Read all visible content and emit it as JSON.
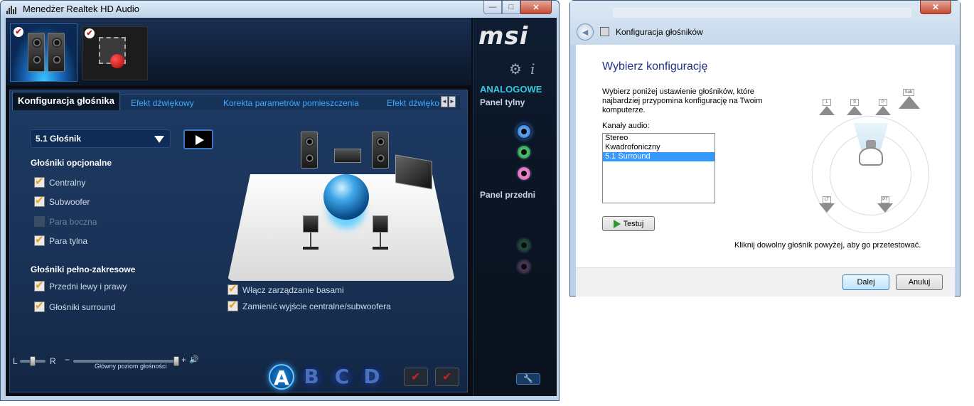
{
  "realtek": {
    "window_title": "Menedżer Realtek HD Audio",
    "title_buttons": {
      "minimize": "—",
      "maximize": "□",
      "close": "✕"
    },
    "brand": "msi",
    "devices": [
      {
        "name": "speakers",
        "checked": true,
        "active": true
      },
      {
        "name": "digital-output",
        "checked": true,
        "active": false
      }
    ],
    "side": {
      "gear_icon": "⚙",
      "info_icon": "i",
      "analog_title": "ANALOGOWE",
      "rear_panel": "Panel tylny",
      "front_panel": "Panel przedni",
      "rear_jacks": [
        "blue",
        "green",
        "pink"
      ],
      "front_jacks": [
        "green",
        "pink"
      ],
      "wrench_icon": "🔧"
    },
    "tabs": {
      "active": "Konfiguracja głośnika",
      "others": [
        "Efekt dźwiękowy",
        "Korekta parametrów pomieszczenia",
        "Efekt dźwięko"
      ],
      "scroll_left": "◄",
      "scroll_right": "►"
    },
    "config_select": "5.1 Głośnik",
    "optional_title": "Głośniki opcjonalne",
    "optional": [
      {
        "label": "Centralny",
        "checked": true,
        "disabled": false
      },
      {
        "label": "Subwoofer",
        "checked": true,
        "disabled": false
      },
      {
        "label": "Para boczna",
        "checked": false,
        "disabled": true
      },
      {
        "label": "Para tylna",
        "checked": true,
        "disabled": false
      }
    ],
    "fullrange_title": "Głośniki pełno-zakresowe",
    "fullrange": [
      {
        "label": "Przedni lewy i prawy",
        "checked": true
      },
      {
        "label": "Głośniki surround",
        "checked": true
      }
    ],
    "options": [
      {
        "label": "Włącz zarządzanie basami",
        "checked": true
      },
      {
        "label": "Zamienić wyjście centralne/subwoofera",
        "checked": true
      }
    ],
    "volume": {
      "title": "Główny poziom głośności",
      "balance_left": "L",
      "balance_right": "R",
      "minus": "−",
      "plus": "+",
      "speaker_icon": "🔊",
      "level": 1.0,
      "balance": 0.5
    },
    "profiles": [
      "A",
      "B",
      "C",
      "D"
    ],
    "active_profile": "A"
  },
  "dialog": {
    "window_title": "Konfiguracja głośników",
    "close": "✕",
    "heading": "Wybierz konfigurację",
    "description": "Wybierz poniżej ustawienie głośników, które najbardziej przypomina konfigurację na Twoim komputerze.",
    "channels_label": "Kanały audio:",
    "channels": [
      "Stereo",
      "Kwadrofoniczny",
      "5.1 Surround"
    ],
    "selected_channel": "5.1 Surround",
    "test_button": "Testuj",
    "hint": "Kliknij dowolny głośnik powyżej, aby go przetestować.",
    "speakers": [
      "L",
      "S",
      "P",
      "Sub",
      "LT",
      "PT"
    ],
    "next_button": "Dalej",
    "cancel_button": "Anuluj"
  }
}
